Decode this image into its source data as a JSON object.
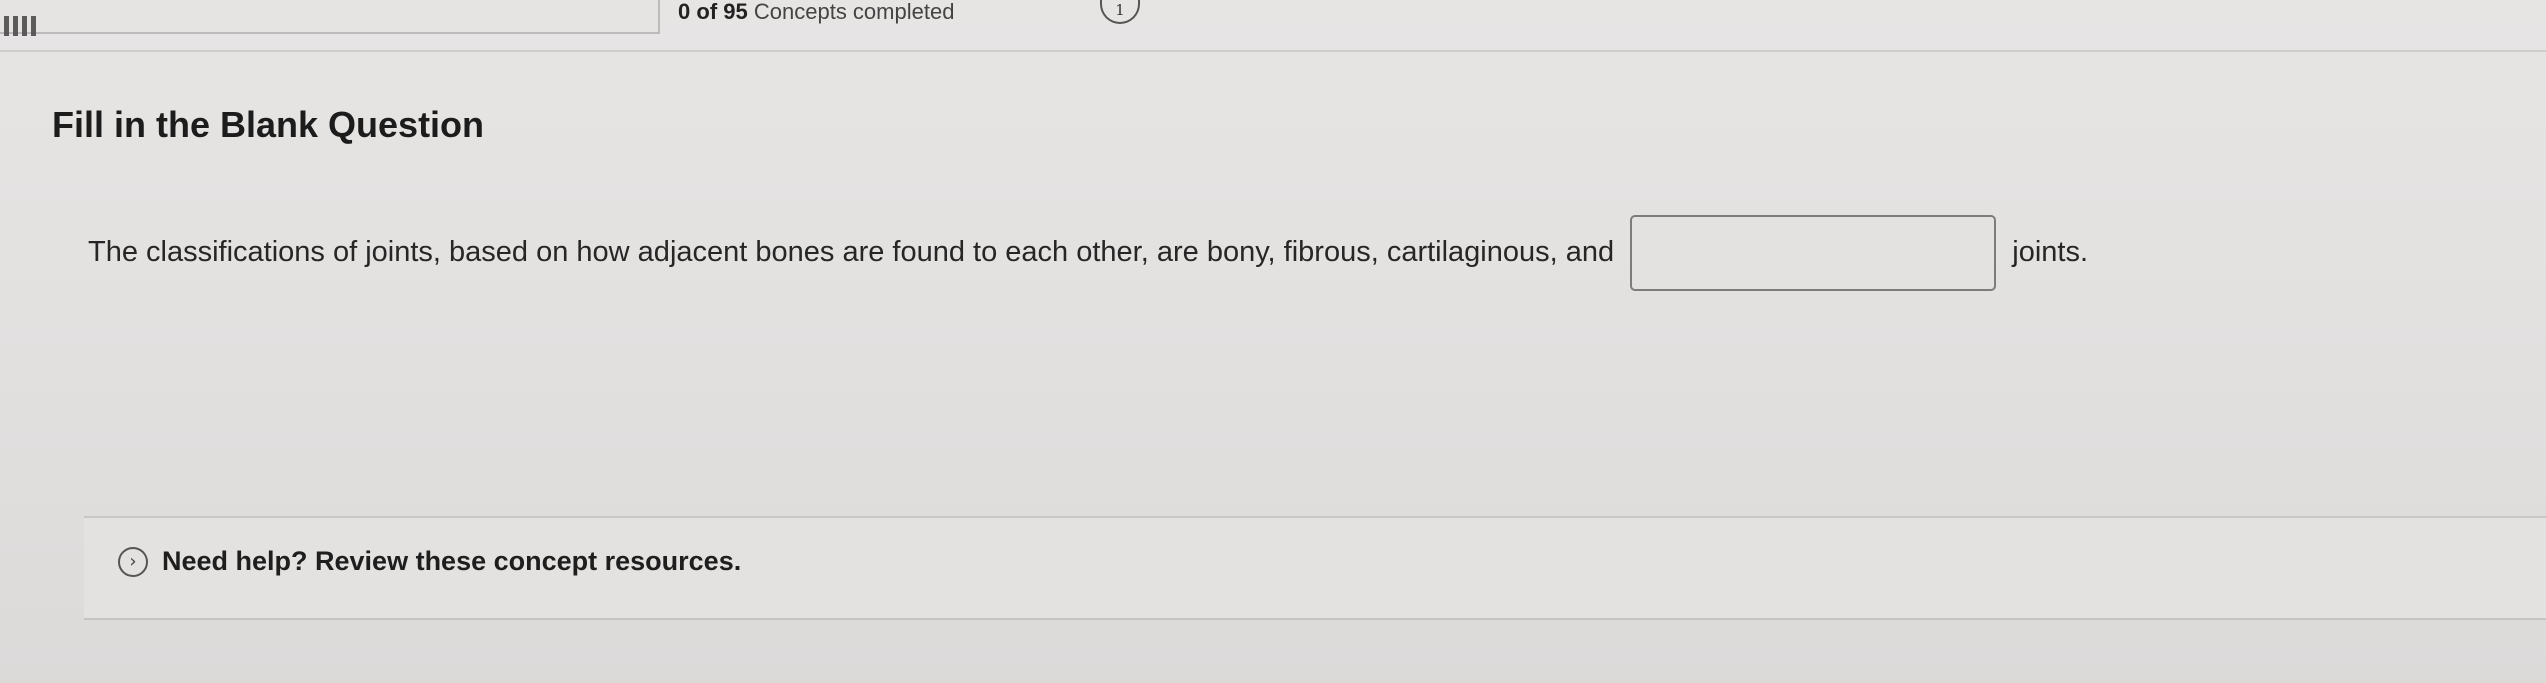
{
  "progress": {
    "completed": "0",
    "of_word": "of",
    "total": "95",
    "suffix": "Concepts completed",
    "fill_fraction": 0.0,
    "concept_badge": "1",
    "accent": "#2c6fb3"
  },
  "question": {
    "title": "Fill in the Blank Question",
    "text_before": "The classifications of joints, based on how adjacent bones are found to each other, are bony, fibrous, cartilaginous, and",
    "blank_value": "",
    "text_after": "joints."
  },
  "help": {
    "icon": "chevron-right-circle-icon",
    "label": "Need help? Review these concept resources."
  }
}
